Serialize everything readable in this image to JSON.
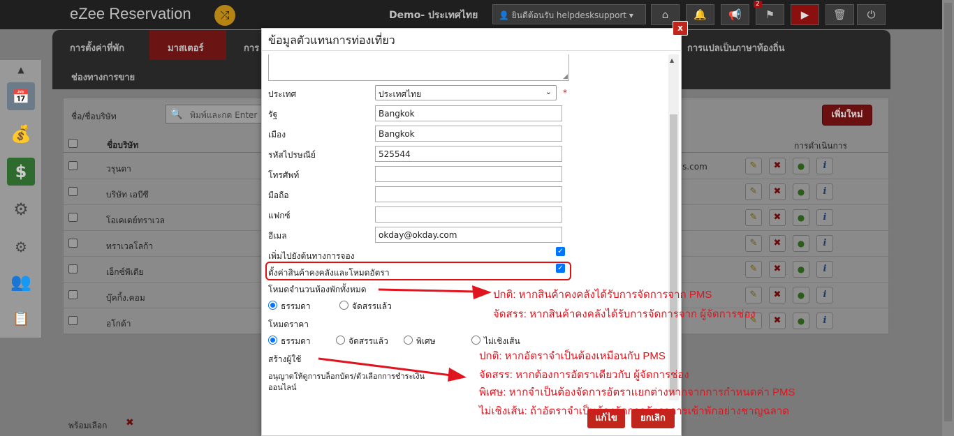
{
  "topbar": {
    "app_title": "eZee Reservation",
    "shuffle_icon": "shuffle-icon",
    "demo_label": "Demo- ประเทศไทย",
    "user_menu": "ยินดีต้อนรับ helpdesksupport",
    "icons": [
      "home-icon",
      "bell-icon",
      "megaphone-icon",
      "flag-icon",
      "youtube-icon",
      "trash-icon",
      "logout-icon"
    ],
    "flag_badge": "2"
  },
  "nav": {
    "items": [
      "การตั้งค่าที่พัก",
      "มาสเตอร์",
      "การ",
      "การแปลเป็นภาษาท้องถิ่น",
      "ช่องทางการขาย"
    ],
    "active_color": "#6b1414"
  },
  "list": {
    "search_label": "ชื่อ/ชื่อบริษัท",
    "search_placeholder": "พิมพ์และกด Enter",
    "add_button": "เพิ่มใหม่",
    "col_name": "ชื่อบริษัท",
    "col_action": "การดำเนินการ",
    "rows": [
      "วรุนดา",
      "บริษัท เอบีซี",
      "โอเคเดย์ทราเวล",
      "ทราเวลโลก้า",
      "เอ็กซ์พีเดีย",
      "บุ๊คกิ้ง.คอม",
      "อโกด้า"
    ],
    "email_fragment": "ys.com",
    "bottom_label": "พร้อมเลือก"
  },
  "modal": {
    "title": "ข้อมูลตัวแทนการท่องเที่ยว",
    "close_label": "x",
    "fields": {
      "country_label": "ประเทศ",
      "country_value": "ประเทศไทย",
      "required_mark": "*",
      "state_label": "รัฐ",
      "state_value": "Bangkok",
      "city_label": "เมือง",
      "city_value": "Bangkok",
      "zip_label": "รหัสไปรษณีย์",
      "zip_value": "525544",
      "phone_label": "โทรศัพท์",
      "phone_value": "",
      "mobile_label": "มือถือ",
      "mobile_value": "",
      "fax_label": "แฟกซ์",
      "fax_value": "",
      "email_label": "อีเมล",
      "email_value": "okday@okday.com"
    },
    "add_channel_label": "เพิ่มไปยังต้นทางการจอง",
    "add_channel_checked": true,
    "inventory_label": "ตั้งค่าสินค้าคงคลังและโหมดอัตรา",
    "inventory_checked": true,
    "room_mode_label": "โหมดจำนวนห้องพักทั้งหมด",
    "room_mode_options": [
      "ธรรมดา",
      "จัดสรรแล้ว"
    ],
    "room_mode_selected": "ธรรมดา",
    "rate_mode_label": "โหมดราคา",
    "rate_mode_options": [
      "ธรรมดา",
      "จัดสรรแล้ว",
      "พิเศษ",
      "ไม่เชิงเส้น"
    ],
    "rate_mode_selected": "ธรรมดา",
    "create_user_label": "สร้างผู้ใช้",
    "allow_block_label_1": "อนุญาตให้ดูการบล็อกบัตร/ตัวเลือกการชำระเงิน",
    "allow_block_label_2": "ออนไลน์",
    "save_button": "แก้ไข",
    "cancel_button": "ยกเลิก"
  },
  "annotations": {
    "note_1_line_1": "ปกติ: หากสินค้าคงคลังได้รับการจัดการจาก PMS",
    "note_1_line_2": "จัดสรร: หากสินค้าคงคลังได้รับการจัดการจาก ผู้จัดการช่อง",
    "note_2_line_1": "ปกติ: หากอัตราจำเป็นต้องเหมือนกับ PMS",
    "note_2_line_2": "จัดสรร: หากต้องการอัตราเดียวกับ ผู้จัดการช่อง",
    "note_2_line_3": "พิเศษ: หากจำเป็นต้องจัดการอัตราแยกต่างหากจากการกำหนดค่า PMS",
    "note_2_line_4": "ไม่เชิงเส้น: ถ้าอัตราจำเป็นต้องจัดการอัตราการเข้าพักอย่างชาญฉลาด",
    "color": "#e0141e"
  }
}
